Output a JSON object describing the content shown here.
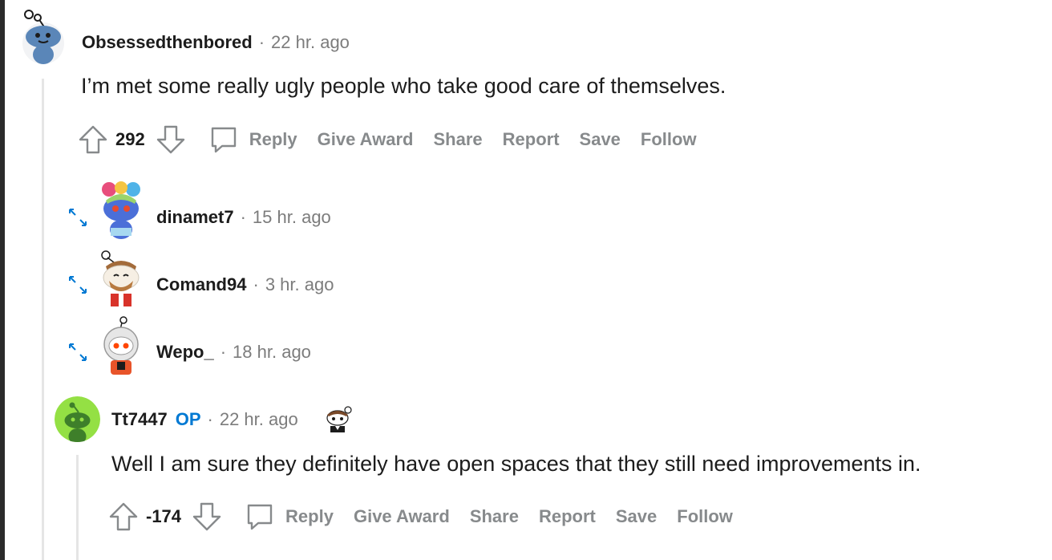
{
  "colors": {
    "accent": "#0079d3",
    "muted": "#878a8c",
    "text": "#1c1c1c"
  },
  "comments": [
    {
      "username": "Obsessedthenbored",
      "time": "22 hr. ago",
      "body": "I’m met some really ugly people who take good care of themselves.",
      "score": "292",
      "actions": {
        "reply": "Reply",
        "award": "Give Award",
        "share": "Share",
        "report": "Report",
        "save": "Save",
        "follow": "Follow"
      }
    },
    {
      "username": "Tt7447",
      "badge": "OP",
      "time": "22 hr. ago",
      "body": "Well I am sure they definitely have open spaces that they still need improvements in.",
      "score": "-174",
      "actions": {
        "reply": "Reply",
        "award": "Give Award",
        "share": "Share",
        "report": "Report",
        "save": "Save",
        "follow": "Follow"
      }
    }
  ],
  "collapsed": [
    {
      "username": "dinamet7",
      "time": "15 hr. ago"
    },
    {
      "username": "Comand94",
      "time": "3 hr. ago"
    },
    {
      "username": "Wepo_",
      "time": "18 hr. ago"
    }
  ],
  "separator": "·"
}
